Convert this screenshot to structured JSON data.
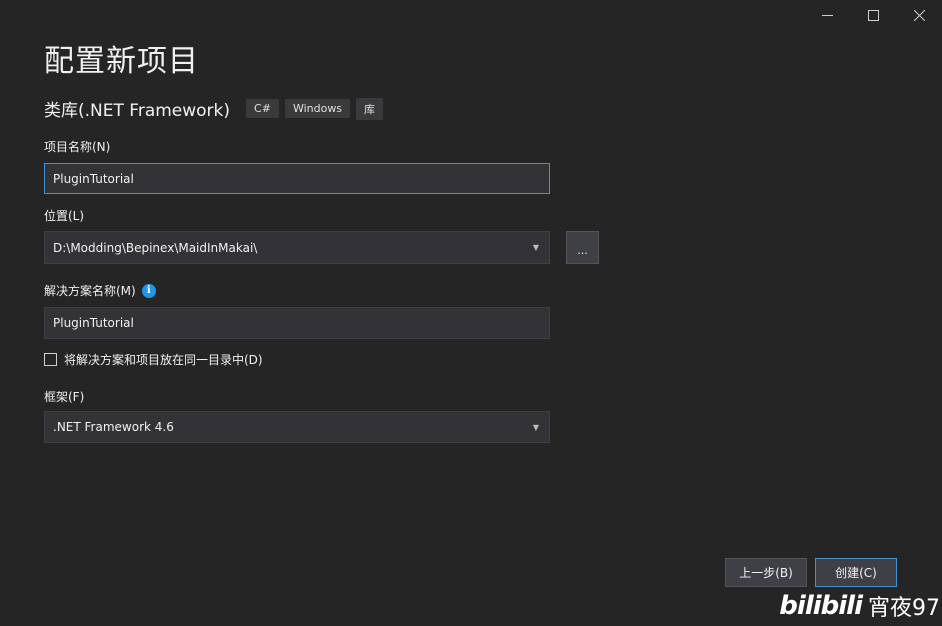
{
  "window": {
    "controls": {
      "minimize": "—",
      "maximize": "☐",
      "close": "✕"
    }
  },
  "page": {
    "title": "配置新项目"
  },
  "template": {
    "name": "类库(.NET Framework)",
    "tags": [
      "C#",
      "Windows",
      "库"
    ]
  },
  "project_name": {
    "label": "项目名称(N)",
    "value": "PluginTutorial"
  },
  "location": {
    "label": "位置(L)",
    "value": "D:\\Modding\\Bepinex\\MaidInMakai\\",
    "browse_label": "..."
  },
  "solution_name": {
    "label": "解决方案名称(M)",
    "info_icon": "i",
    "value": "PluginTutorial"
  },
  "same_directory": {
    "label": "将解决方案和项目放在同一目录中(D)",
    "checked": false
  },
  "framework": {
    "label": "框架(F)",
    "value": ".NET Framework 4.6"
  },
  "buttons": {
    "back": "上一步(B)",
    "create": "创建(C)"
  },
  "watermark": {
    "logo": "bilibili",
    "user": "宵夜97"
  },
  "colors": {
    "background": "#252526",
    "field": "#333337",
    "focus_accent": "#3e95d6",
    "info_icon": "#1c97ea"
  }
}
